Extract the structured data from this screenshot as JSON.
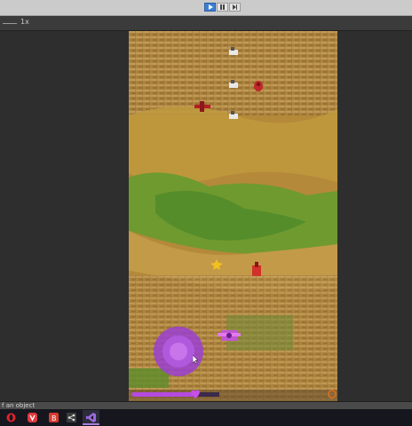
{
  "toolbar": {
    "play_state": "playing",
    "buttons": [
      "play-icon",
      "pause-icon",
      "step-icon"
    ]
  },
  "game_view": {
    "scale_label": "1x"
  },
  "game": {
    "joystick_color": "#9b3fd2",
    "health_bar_color": "#b44be0",
    "terrain_colors": [
      "#b88d3c",
      "#6f9a2f",
      "#c9a253",
      "#9c6e35"
    ]
  },
  "status_bar": {
    "text": "f an object"
  },
  "taskbar": {
    "icons": [
      "opera-icon",
      "vivaldi-icon",
      "brave-icon",
      "share-icon",
      "visual-studio-icon"
    ]
  }
}
